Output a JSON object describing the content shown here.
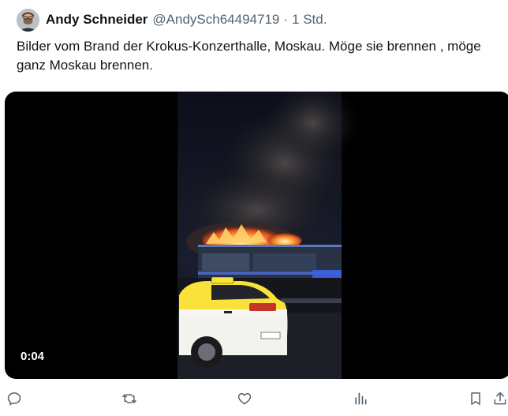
{
  "tweet": {
    "author_name": "Andy Schneider",
    "author_handle": "@AndySch64494719",
    "separator": "·",
    "time": "1 Std.",
    "text": "Bilder vom Brand der Krokus-Konzerthalle, Moskau. Möge sie brennen , möge ganz Moskau brennen.",
    "video_duration": "0:04"
  },
  "icons": {
    "reply": "reply-icon",
    "retweet": "retweet-icon",
    "like": "like-icon",
    "views": "views-icon",
    "bookmark": "bookmark-icon",
    "share": "share-icon"
  },
  "colors": {
    "text_primary": "#0f1419",
    "text_secondary": "#536471",
    "taxi": "#fbe23a"
  }
}
